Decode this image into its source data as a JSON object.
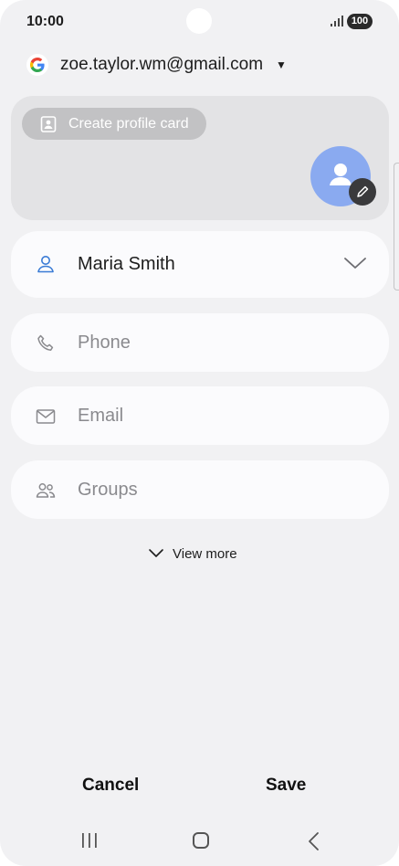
{
  "status_bar": {
    "time": "10:00",
    "battery": "100"
  },
  "account": {
    "email": "zoe.taylor.wm@gmail.com",
    "provider_icon": "google-g-icon"
  },
  "profile_card": {
    "create_label": "Create profile card",
    "avatar_icon": "person-avatar-icon",
    "edit_icon": "pencil-icon"
  },
  "fields": {
    "name": {
      "value": "Maria Smith",
      "icon": "person-icon"
    },
    "phone": {
      "placeholder": "Phone",
      "icon": "phone-icon"
    },
    "email": {
      "placeholder": "Email",
      "icon": "mail-icon"
    },
    "groups": {
      "placeholder": "Groups",
      "icon": "groups-icon"
    }
  },
  "view_more": {
    "label": "View more"
  },
  "actions": {
    "cancel": "Cancel",
    "save": "Save"
  },
  "colors": {
    "background": "#f1f1f3",
    "accent": "#3a7bd5",
    "avatar": "#8aaaf0"
  }
}
